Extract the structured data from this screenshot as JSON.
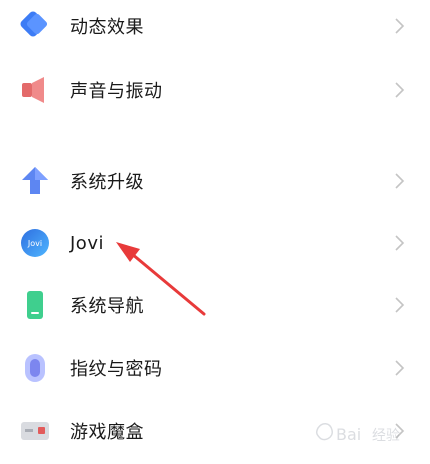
{
  "settings_items": [
    {
      "label": "动态效果"
    },
    {
      "label": "声音与振动"
    },
    {
      "label": "系统升级"
    },
    {
      "label": "Jovi",
      "icon_text": "Jovi"
    },
    {
      "label": "系统导航"
    },
    {
      "label": "指纹与密码"
    },
    {
      "label": "游戏魔盒"
    }
  ],
  "icons": [
    "diamond-icon",
    "speaker-icon",
    "upload-arrow-icon",
    "jovi-logo-icon",
    "phone-icon",
    "fingerprint-icon",
    "game-box-icon"
  ],
  "annotation": {
    "color": "#e83a3a"
  },
  "watermark": {
    "text": "Baidu 经验"
  }
}
